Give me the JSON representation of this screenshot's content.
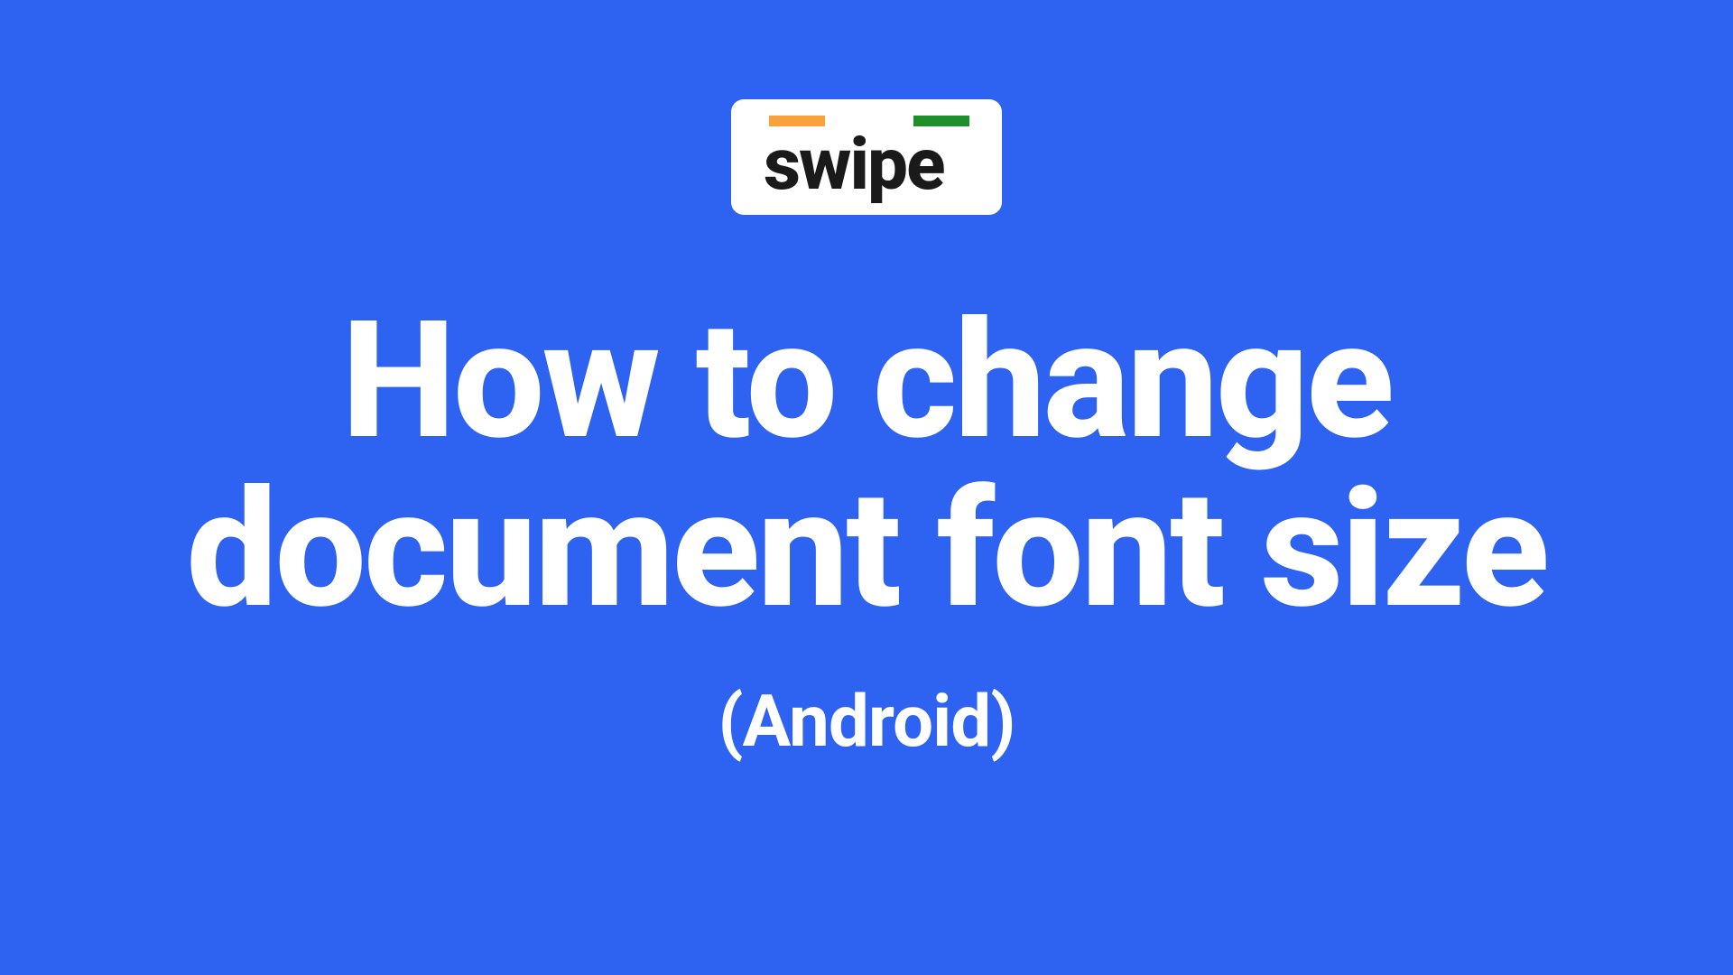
{
  "logo": {
    "text": "swipe",
    "bar_colors": [
      "#f7a23b",
      "#ffffff",
      "#1e8f2a"
    ]
  },
  "title": "How to change document font size",
  "subtitle": "(Android)",
  "background_color": "#2e62f0"
}
